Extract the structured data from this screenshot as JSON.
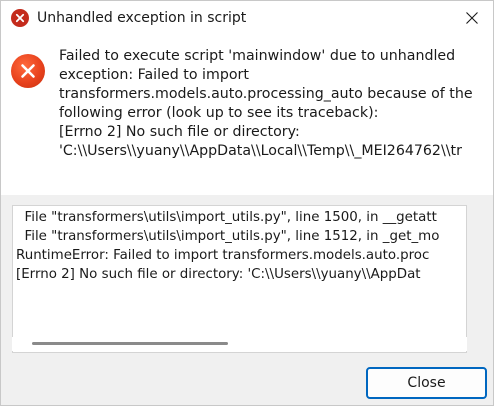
{
  "window": {
    "title": "Unhandled exception in script",
    "title_icon": "error-icon",
    "close_icon": "close-icon"
  },
  "message": {
    "icon": "error-icon",
    "lines": [
      "Failed to execute script 'mainwindow' due to unhandled",
      "exception: Failed to import",
      "transformers.models.auto.processing_auto because of the",
      "following error (look up to see its traceback):",
      "[Errno 2] No such file or directory:",
      "'C:\\\\Users\\\\yuany\\\\AppData\\\\Local\\\\Temp\\\\_MEI264762\\\\tr"
    ]
  },
  "traceback": {
    "lines": [
      "  File \"transformers\\utils\\import_utils.py\", line 1500, in __getatt",
      "  File \"transformers\\utils\\import_utils.py\", line 1512, in _get_mo",
      "RuntimeError: Failed to import transformers.models.auto.proc",
      "[Errno 2] No such file or directory: 'C:\\\\Users\\\\yuany\\\\AppDat"
    ]
  },
  "buttons": {
    "close_label": "Close"
  },
  "colors": {
    "error_red": "#c42b1c",
    "accent_blue": "#0067c0"
  }
}
